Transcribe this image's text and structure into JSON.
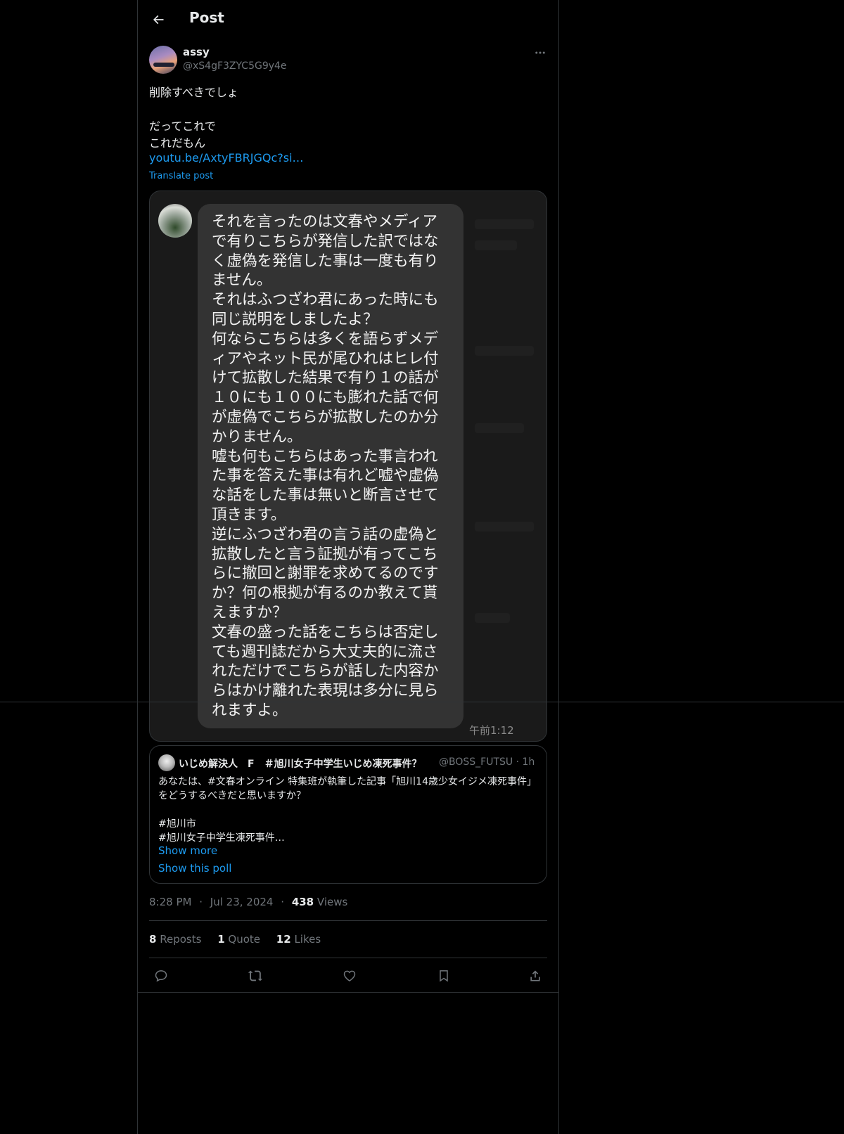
{
  "header": {
    "title": "Post"
  },
  "author": {
    "name": "assy",
    "handle": "@xS4gF3ZYC5G9y4e"
  },
  "post": {
    "text": "削除すべきでしょ\n\nだってこれで\nこれだもん",
    "link": "youtu.be/AxtyFBRJGQc?si…",
    "translate_label": "Translate post"
  },
  "media": {
    "message": "それを言ったのは文春やメディア\nで有りこちらが発信した訳ではな\nく虚偽を発信した事は一度も有り\nません。\nそれはふつざわ君にあった時にも\n同じ説明をしましたよ？\n何ならこちらは多くを語らずメデ\nィアやネット民が尾ひれはヒレ付\nけて拡散した結果で有り１の話が\n１０にも１００にも膨れた話で何\nが虚偽でこちらが拡散したのか分\nかりません。\n嘘も何もこちらはあった事言われ\nた事を答えた事は有れど嘘や虚偽\nな話をした事は無いと断言させて\n頂きます。\n逆にふつざわ君の言う話の虚偽と\n拡散したと言う証拠が有ってこち\nらに撤回と謝罪を求めてるのです\nか？何の根拠が有るのか教えて貰\nえますか？\n文春の盛った話をこちらは否定し\nても週刊誌だから大丈夫的に流さ\nれただけでこちらが話した内容か\nらはかけ離れた表現は多分に見ら\nれますよ。",
    "time": "午前1:12"
  },
  "quote": {
    "name": "いじめ解決人　F　＃旭川女子中学生いじめ凍死事件？",
    "handle": "@BOSS_FUTSU · 1h",
    "text": "あなたは、#文春オンライン 特集班が執筆した記事「旭川14歳少女イジメ凍死事件」をどうするべきだと思いますか？\n\n#旭川市\n#旭川女子中学生凍死事件…",
    "show_more": "Show more",
    "show_poll": "Show this poll"
  },
  "meta": {
    "time": "8:28 PM",
    "sep": "·",
    "date": "Jul 23, 2024",
    "views_count": "438",
    "views_label": "Views"
  },
  "stats": {
    "reposts_count": "8",
    "reposts_label": "Reposts",
    "quotes_count": "1",
    "quotes_label": "Quote",
    "likes_count": "12",
    "likes_label": "Likes"
  },
  "icons": [
    "back-arrow-icon",
    "more-icon",
    "reply-icon",
    "repost-icon",
    "like-icon",
    "bookmark-icon",
    "share-icon"
  ],
  "colors": {
    "accent": "#1d9bf0",
    "background": "#000000",
    "border": "#2f3336",
    "muted": "#71767b"
  }
}
